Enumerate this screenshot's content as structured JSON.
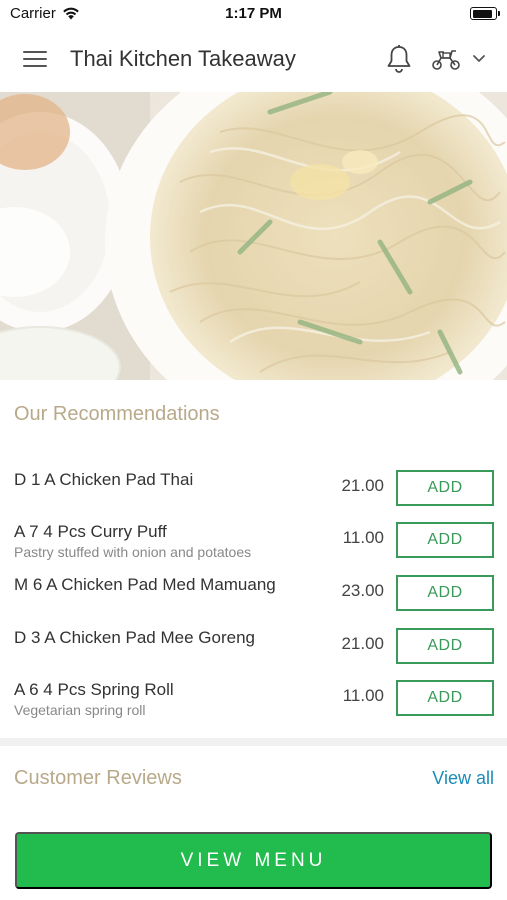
{
  "status_bar": {
    "carrier": "Carrier",
    "time": "1:17 PM"
  },
  "header": {
    "title": "Thai Kitchen Takeaway",
    "icons": [
      "menu-icon",
      "bell-icon",
      "scooter-icon",
      "chevron-down-icon"
    ]
  },
  "recommendations": {
    "title": "Our Recommendations",
    "add_label": "ADD",
    "items": [
      {
        "name": "D 1 A Chicken Pad Thai",
        "description": "",
        "price": "21.00"
      },
      {
        "name": "A 7 4 Pcs Curry Puff",
        "description": "Pastry stuffed with onion and potatoes",
        "price": "11.00"
      },
      {
        "name": "M 6 A Chicken Pad Med Mamuang",
        "description": "",
        "price": "23.00"
      },
      {
        "name": "D 3 A Chicken Pad Mee Goreng",
        "description": "",
        "price": "21.00"
      },
      {
        "name": "A 6 4 Pcs Spring Roll",
        "description": "Vegetarian spring roll",
        "price": "11.00"
      }
    ]
  },
  "reviews": {
    "title": "Customer Reviews",
    "view_all_label": "View all"
  },
  "footer": {
    "view_menu_label": "VIEW MENU"
  },
  "colors": {
    "accent_green": "#22bb4d",
    "add_border": "#3a9a5a",
    "section_title": "#b8a98a",
    "link": "#1a8cb8"
  }
}
